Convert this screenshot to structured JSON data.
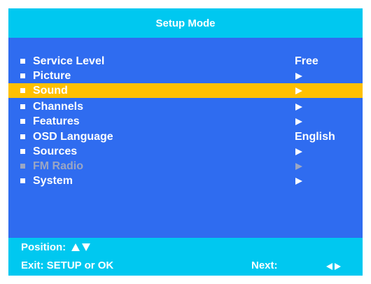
{
  "title": "Setup Mode",
  "colors": {
    "title_bar": "#00c8f0",
    "menu_bg": "#2f6cf0",
    "highlight": "#ffc000",
    "text": "#ffffff",
    "disabled_text": "#9aa6c4"
  },
  "menu": {
    "items": [
      {
        "label": "Service Level",
        "value": "Free",
        "icon": "none"
      },
      {
        "label": "Picture",
        "value": "",
        "icon": "arrow-right-icon"
      },
      {
        "label": "Sound",
        "value": "",
        "icon": "arrow-right-icon",
        "selected": true
      },
      {
        "label": "Channels",
        "value": "",
        "icon": "arrow-right-icon"
      },
      {
        "label": "Features",
        "value": "",
        "icon": "arrow-right-icon"
      },
      {
        "label": "OSD Language",
        "value": "English",
        "icon": "none"
      },
      {
        "label": "Sources",
        "value": "",
        "icon": "arrow-right-icon"
      },
      {
        "label": "FM Radio",
        "value": "",
        "icon": "arrow-right-icon",
        "disabled": true
      },
      {
        "label": "System",
        "value": "",
        "icon": "arrow-right-icon"
      }
    ]
  },
  "footer": {
    "position_label": "Position:",
    "exit_label": "Exit: SETUP or OK",
    "next_label": "Next:"
  }
}
